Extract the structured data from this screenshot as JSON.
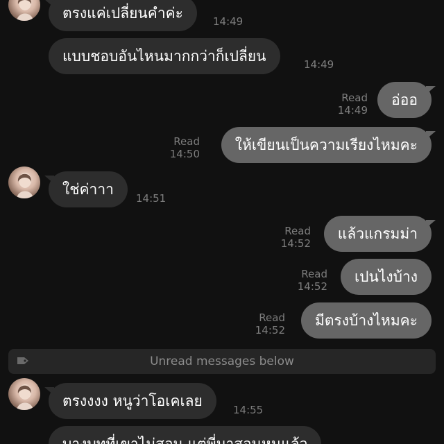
{
  "messages": [
    {
      "text": "ตรงแค่เปลี่ยนคำค่ะ",
      "time": "14:49"
    },
    {
      "text": "แบบชอบอันไหนมากกว่าก็เปลี่ยน",
      "time": "14:49"
    },
    {
      "text": "อ่ออ",
      "status": "Read",
      "time": "14:49"
    },
    {
      "text": "ให้เขียนเป็นความเรียงไหมคะ",
      "status": "Read",
      "time": "14:50"
    },
    {
      "text": "ใช่ค่าาา",
      "time": "14:51"
    },
    {
      "text": "แล้วแกรมม่า",
      "status": "Read",
      "time": "14:52"
    },
    {
      "text": "เปนไงบ้าง",
      "status": "Read",
      "time": "14:52"
    },
    {
      "text": "มีตรงบ้างไหมคะ",
      "status": "Read",
      "time": "14:52"
    },
    {
      "text": "ตรงงงง หนูว่าโอเคเลย",
      "time": "14:55"
    },
    {
      "text": "บางบทที่เขาไม่สอน แต่พี่มาสอนหนูแล้ว"
    }
  ],
  "divider": {
    "label": "Unread messages below",
    "icon": "tag-icon"
  },
  "colors": {
    "background": "#111111",
    "incoming_bubble": "#2d2d2d",
    "outgoing_bubble": "#666666",
    "meta_text": "#7d7d7d"
  }
}
